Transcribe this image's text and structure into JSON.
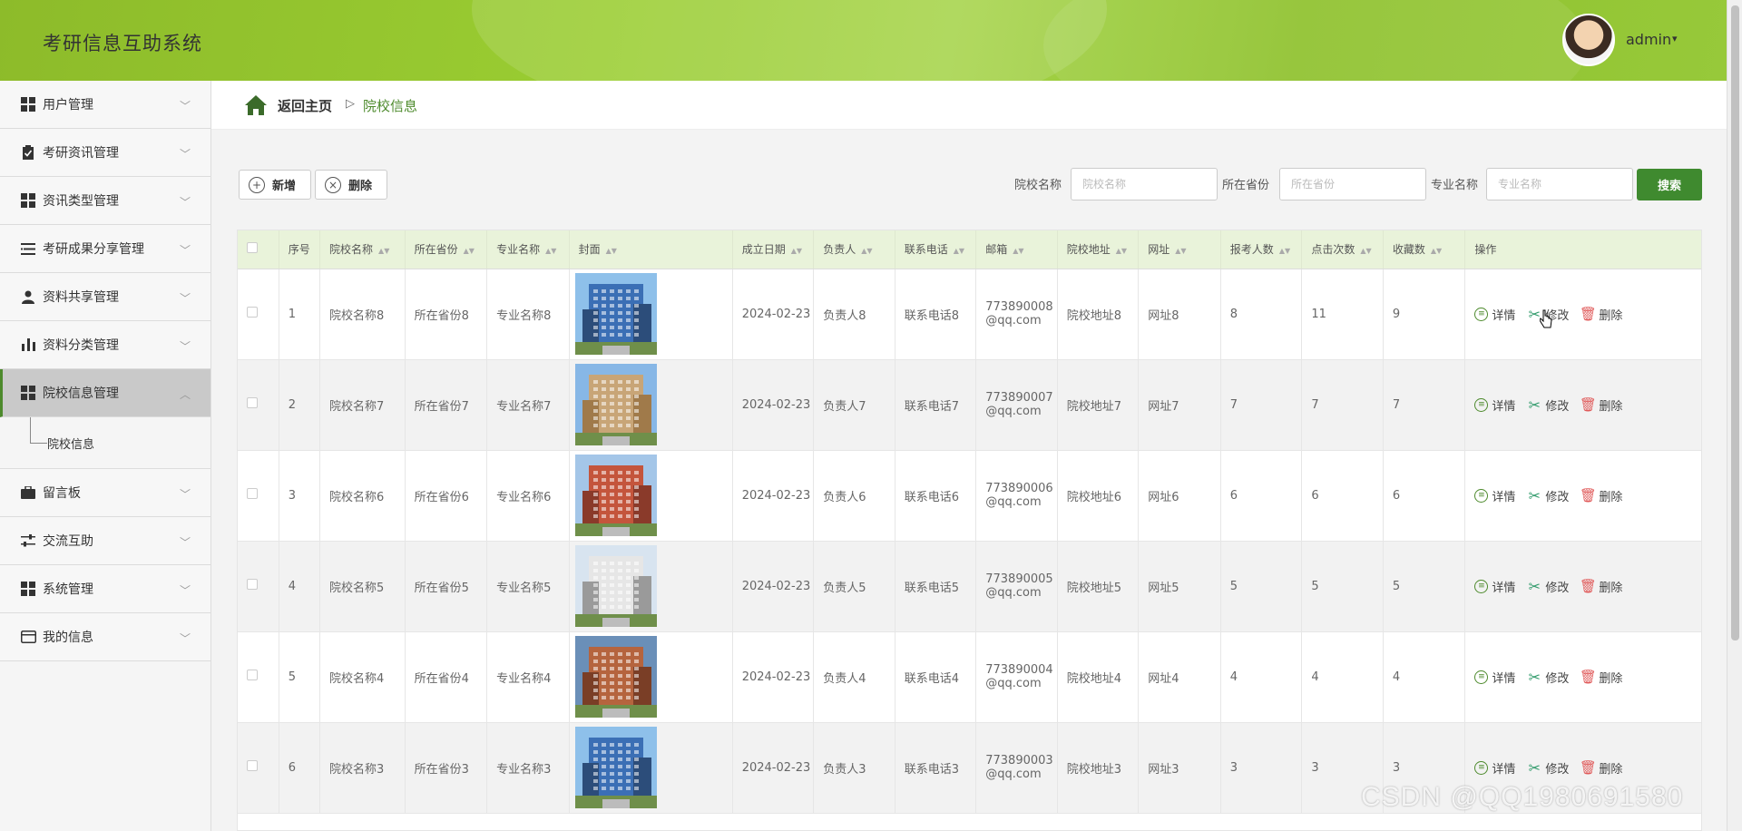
{
  "header": {
    "title": "考研信息互助系统",
    "user": "admin",
    "caret": "⌄"
  },
  "sidebar": {
    "items": [
      {
        "label": "用户管理",
        "icon": "grid-icon"
      },
      {
        "label": "考研资讯管理",
        "icon": "clipboard-icon"
      },
      {
        "label": "资讯类型管理",
        "icon": "grid-icon"
      },
      {
        "label": "考研成果分享管理",
        "icon": "list-icon"
      },
      {
        "label": "资料共享管理",
        "icon": "user-icon"
      },
      {
        "label": "资料分类管理",
        "icon": "bar-chart-icon"
      },
      {
        "label": "院校信息管理",
        "icon": "grid-icon",
        "active": true
      },
      {
        "label": "留言板",
        "icon": "briefcase-icon"
      },
      {
        "label": "交流互助",
        "icon": "sliders-icon"
      },
      {
        "label": "系统管理",
        "icon": "grid-icon"
      },
      {
        "label": "我的信息",
        "icon": "card-icon"
      }
    ],
    "submenu": "院校信息"
  },
  "breadcrumb": {
    "home": "返回主页",
    "separator": "▷",
    "current": "院校信息"
  },
  "toolbar": {
    "add": "新增",
    "delete": "删除"
  },
  "search": {
    "school_label": "院校名称",
    "school_placeholder": "院校名称",
    "province_label": "所在省份",
    "province_placeholder": "所在省份",
    "major_label": "专业名称",
    "major_placeholder": "专业名称",
    "button": "搜索"
  },
  "table": {
    "headers": [
      "序号",
      "院校名称",
      "所在省份",
      "专业名称",
      "封面",
      "成立日期",
      "负责人",
      "联系电话",
      "邮箱",
      "院校地址",
      "网址",
      "报考人数",
      "点击次数",
      "收藏数",
      "操作"
    ],
    "ops": {
      "detail": "详情",
      "edit": "修改",
      "delete": "删除"
    },
    "rows": [
      {
        "no": "1",
        "school": "院校名称8",
        "province": "所在省份8",
        "major": "专业名称8",
        "date": "2024-02-23",
        "leader": "负责人8",
        "phone": "联系电话8",
        "email": "773890008@qq.com",
        "address": "院校地址8",
        "site": "网址8",
        "applicants": "8",
        "clicks": "11",
        "favs": "9"
      },
      {
        "no": "2",
        "school": "院校名称7",
        "province": "所在省份7",
        "major": "专业名称7",
        "date": "2024-02-23",
        "leader": "负责人7",
        "phone": "联系电话7",
        "email": "773890007@qq.com",
        "address": "院校地址7",
        "site": "网址7",
        "applicants": "7",
        "clicks": "7",
        "favs": "7"
      },
      {
        "no": "3",
        "school": "院校名称6",
        "province": "所在省份6",
        "major": "专业名称6",
        "date": "2024-02-23",
        "leader": "负责人6",
        "phone": "联系电话6",
        "email": "773890006@qq.com",
        "address": "院校地址6",
        "site": "网址6",
        "applicants": "6",
        "clicks": "6",
        "favs": "6"
      },
      {
        "no": "4",
        "school": "院校名称5",
        "province": "所在省份5",
        "major": "专业名称5",
        "date": "2024-02-23",
        "leader": "负责人5",
        "phone": "联系电话5",
        "email": "773890005@qq.com",
        "address": "院校地址5",
        "site": "网址5",
        "applicants": "5",
        "clicks": "5",
        "favs": "5"
      },
      {
        "no": "5",
        "school": "院校名称4",
        "province": "所在省份4",
        "major": "专业名称4",
        "date": "2024-02-23",
        "leader": "负责人4",
        "phone": "联系电话4",
        "email": "773890004@qq.com",
        "address": "院校地址4",
        "site": "网址4",
        "applicants": "4",
        "clicks": "4",
        "favs": "4"
      },
      {
        "no": "6",
        "school": "院校名称3",
        "province": "所在省份3",
        "major": "专业名称3",
        "date": "2024-02-23",
        "leader": "负责人3",
        "phone": "联系电话3",
        "email": "773890003@qq.com",
        "address": "院校地址3",
        "site": "网址3",
        "applicants": "3",
        "clicks": "3",
        "favs": "3"
      }
    ]
  },
  "watermark": "CSDN @QQ1980691580",
  "colors": {
    "header_green": "#9acd32",
    "accent_green": "#3f8a2f",
    "header_row": "#e9f3da"
  }
}
